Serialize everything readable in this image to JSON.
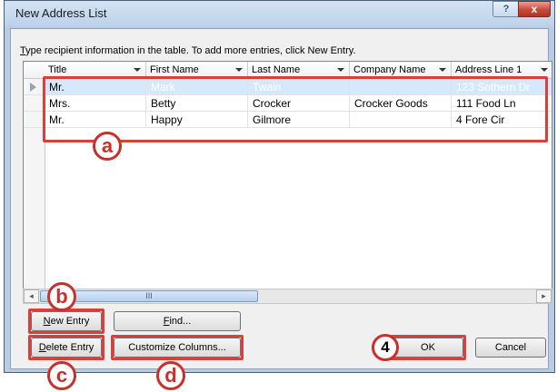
{
  "window": {
    "title": "New Address List",
    "help_glyph": "?",
    "close_glyph": "x"
  },
  "instructions": {
    "first_char": "T",
    "rest": "ype recipient information in the table.  To add more entries, click New Entry."
  },
  "table": {
    "columns": [
      {
        "label": "Title"
      },
      {
        "label": "First Name"
      },
      {
        "label": "Last Name"
      },
      {
        "label": "Company Name"
      },
      {
        "label": "Address Line 1"
      }
    ],
    "rows": [
      {
        "selected": true,
        "cells": [
          "Mr.",
          "Mark",
          "Twain",
          "",
          "123 Sothern Dr"
        ]
      },
      {
        "selected": false,
        "cells": [
          "Mrs.",
          "Betty",
          "Crocker",
          "Crocker Goods",
          "111 Food Ln"
        ]
      },
      {
        "selected": false,
        "cells": [
          "Mr.",
          "Happy",
          "Gilmore",
          "",
          "4 Fore Cir"
        ]
      }
    ]
  },
  "scrollbar": {
    "left_glyph": "◂",
    "right_glyph": "▸",
    "thumb_grip": "III"
  },
  "buttons": {
    "new_entry": {
      "first": "N",
      "rest": "ew Entry"
    },
    "find": {
      "first": "F",
      "rest": "ind..."
    },
    "delete_entry": {
      "first": "D",
      "rest": "elete Entry"
    },
    "customize_columns": {
      "first": "",
      "rest": "Customize Columns..."
    },
    "ok": "OK",
    "cancel": "Cancel"
  },
  "annotations": {
    "a": "a",
    "b": "b",
    "c": "c",
    "d": "d",
    "step": "4",
    "highlight_color": "#d9403a"
  }
}
